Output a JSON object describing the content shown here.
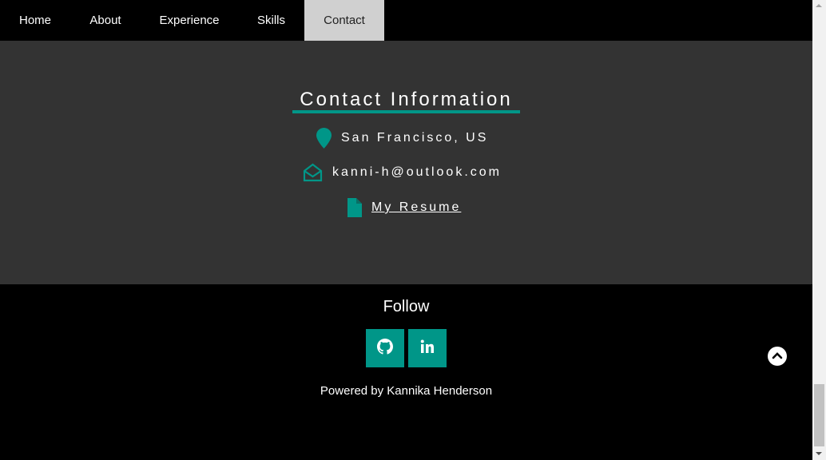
{
  "nav": {
    "items": [
      {
        "label": "Home"
      },
      {
        "label": "About"
      },
      {
        "label": "Experience"
      },
      {
        "label": "Skills"
      },
      {
        "label": "Contact",
        "active": true
      }
    ]
  },
  "contact": {
    "title": "Contact Information",
    "location": "San Francisco, US",
    "email": "kanni-h@outlook.com",
    "resume_label": "My Resume"
  },
  "footer": {
    "follow_label": "Follow",
    "social": [
      {
        "icon": "github-icon"
      },
      {
        "icon": "linkedin-icon"
      }
    ],
    "powered_by": "Powered by Kannika Henderson"
  },
  "colors": {
    "accent": "#009688",
    "contact_bg": "#333333",
    "nav_active_bg": "#d0d0d0"
  }
}
